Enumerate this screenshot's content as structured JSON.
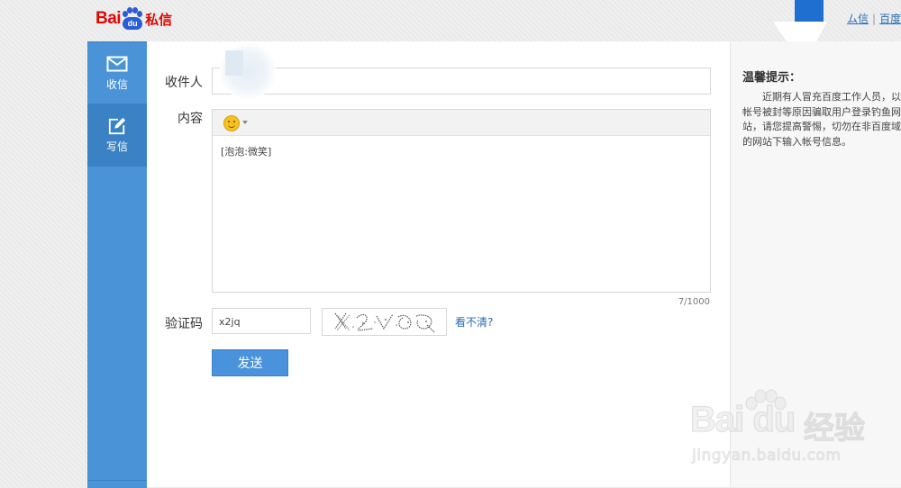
{
  "logo": {
    "text_latin": "Bai",
    "paw_text": "du",
    "text_cn": "私信"
  },
  "header": {
    "links": [
      {
        "label": "ム信"
      },
      {
        "label": "百度"
      }
    ],
    "separator": "|"
  },
  "sidebar": {
    "items": [
      {
        "label": "收信",
        "icon": "envelope-icon",
        "active": false
      },
      {
        "label": "写信",
        "icon": "compose-icon",
        "active": true
      }
    ]
  },
  "form": {
    "recipient_label": "收件人",
    "content_label": "内容",
    "content_value": "[泡泡:微笑]",
    "emoji_button": "smiley-icon",
    "char_counter": "7/1000",
    "captcha_label": "验证码",
    "captcha_value": "x2jq",
    "captcha_refresh": "看不清?",
    "send_button": "发送"
  },
  "tips": {
    "title": "温馨提示：",
    "body": "近期有人冒充百度工作人员，以帐号被封等原因骗取用户登录钓鱼网站，请您提高警惕，切勿在非百度域的网站下输入帐号信息。"
  },
  "watermark": {
    "brand": "Bai du",
    "brand_cn": "经验",
    "url": "jingyan.baidu.com"
  },
  "colors": {
    "sidebar": "#4a93d6",
    "accent": "#4a93dc",
    "logo_red": "#e10602",
    "logo_blue": "#2a5cd6"
  }
}
